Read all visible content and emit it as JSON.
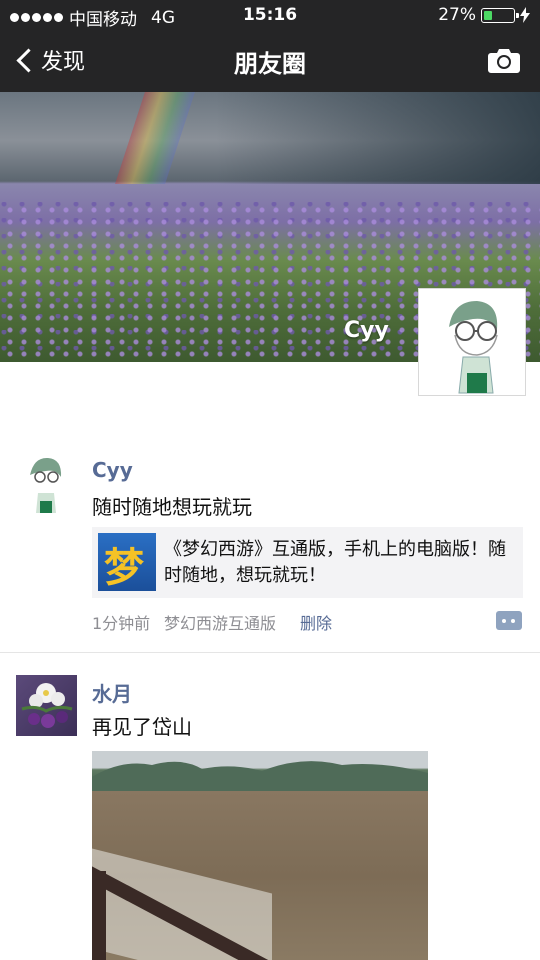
{
  "status_bar": {
    "carrier": "中国移动",
    "network": "4G",
    "time": "15:16",
    "battery": "27%",
    "battery_level": 0.27
  },
  "nav": {
    "back_label": "发现",
    "title": "朋友圈"
  },
  "cover": {
    "user_name": "Cyy"
  },
  "posts": [
    {
      "author": "Cyy",
      "text": "随时随地想玩就玩",
      "link_card": {
        "icon_char": "梦",
        "text": "《梦幻西游》互通版，手机上的电脑版！随时随地，想玩就玩！"
      },
      "time": "1分钟前",
      "source": "梦幻西游互通版",
      "delete_label": "删除"
    },
    {
      "author": "水月",
      "text": "再见了岱山"
    }
  ],
  "colors": {
    "bar_bg": "#252526",
    "link_name": "#576b95",
    "battery_fill": "#4cd964"
  }
}
